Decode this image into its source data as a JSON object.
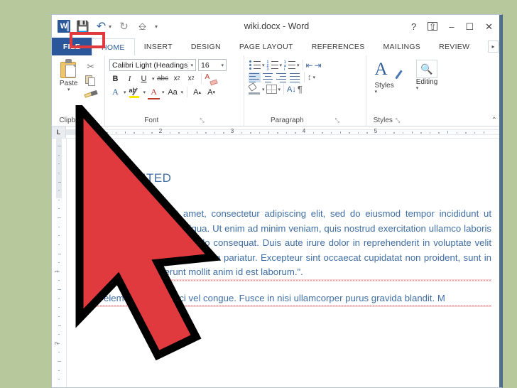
{
  "window": {
    "title": "wiki.docx - Word",
    "quick_access": [
      {
        "name": "word-logo",
        "label": "W"
      },
      {
        "name": "save-icon",
        "label": "💾"
      },
      {
        "name": "undo-icon",
        "label": "↶"
      },
      {
        "name": "redo-icon",
        "label": "↻"
      },
      {
        "name": "touch-mouse-mode-icon",
        "label": "⎘"
      },
      {
        "name": "customize-qat-icon",
        "label": "▾"
      }
    ],
    "controls": {
      "help": "?",
      "ribbon_display_options": "⤒",
      "minimize": "–",
      "maximize": "☐",
      "close": "✕"
    }
  },
  "tabs": {
    "file": "FILE",
    "items": [
      {
        "label": "HOME",
        "active": true
      },
      {
        "label": "INSERT",
        "active": false
      },
      {
        "label": "DESIGN",
        "active": false
      },
      {
        "label": "PAGE LAYOUT",
        "active": false
      },
      {
        "label": "REFERENCES",
        "active": false
      },
      {
        "label": "MAILINGS",
        "active": false
      },
      {
        "label": "REVIEW",
        "active": false
      }
    ],
    "overflow": "▸"
  },
  "ribbon": {
    "collapse_arrow": "⌃",
    "clipboard": {
      "label": "Clipboard",
      "dialog_launcher": "⤡",
      "paste": "Paste",
      "paste_caret": "▾",
      "cut": "✂",
      "copy": "copy",
      "format_painter": "format-painter"
    },
    "font": {
      "label": "Font",
      "dialog_launcher": "⤡",
      "font_name": "Calibri Light (Headings)",
      "font_size": "16",
      "bold": "B",
      "italic": "I",
      "underline": "U",
      "underline_caret": "▾",
      "strikethrough": "abc",
      "subscript": "x",
      "superscript": "x",
      "clear_formatting": "A",
      "text_effects": "A",
      "text_highlight": "ab",
      "font_color": "A",
      "change_case": "Aa",
      "grow_font": "A",
      "shrink_font": "A",
      "caret": "▾"
    },
    "paragraph": {
      "label": "Paragraph",
      "dialog_launcher": "⤡",
      "bullets": "bullets",
      "numbering": "numbering",
      "multilevel_list": "multilevel-list",
      "decrease_indent": "⇤",
      "increase_indent": "⇥",
      "align_left": "align-left",
      "align_center": "align-center",
      "align_right": "align-right",
      "justify": "justify",
      "line_spacing": "↕",
      "shading": "shading",
      "borders": "borders",
      "sort": "sort",
      "show_marks": "¶",
      "caret": "▾"
    },
    "styles": {
      "label": "Styles",
      "dialog_launcher": "⤡",
      "button": "Styles",
      "caret": "▾"
    },
    "editing": {
      "label": "",
      "button": "Editing",
      "icon": "🔍",
      "caret": "▾"
    }
  },
  "ruler": {
    "tab_selector": "L",
    "horizontal_numbers": [
      "2",
      "3",
      "4",
      "5"
    ],
    "vertical_numbers": [
      "1",
      "2"
    ]
  },
  "document": {
    "heading": "WORKS CITED",
    "paragraph1": "Lorem ipsum dolor sit amet, consectetur adipiscing elit, sed do eiusmod tempor incididunt ut labore et dolore magna aliqua. Ut enim ad minim veniam, quis nostrud exercitation ullamco laboris nisi ut aliquip ex ea commodo consequat. Duis aute irure dolor in reprehenderit in voluptate velit esse cillum dolore eu fugiat nulla pariatur. Excepteur sint occaecat cupidatat non proident, sunt in culpa qui officia deserunt mollit anim id est laborum.\".",
    "paragraph2": "Duis elementum non orci vel congue. Fusce in nisi ullamcorper purus gravida blandit. M"
  },
  "colors": {
    "desktop_background": "#b7c89c",
    "word_blue": "#2b579a",
    "text_blue": "#3f6ea5",
    "callout_red": "#e03a3e",
    "cursor_red": "#e03a3e",
    "highlight_yellow": "#ffe600"
  },
  "callout": {
    "name": "text-highlight-color-callout",
    "target": "text-highlight-color-button"
  }
}
